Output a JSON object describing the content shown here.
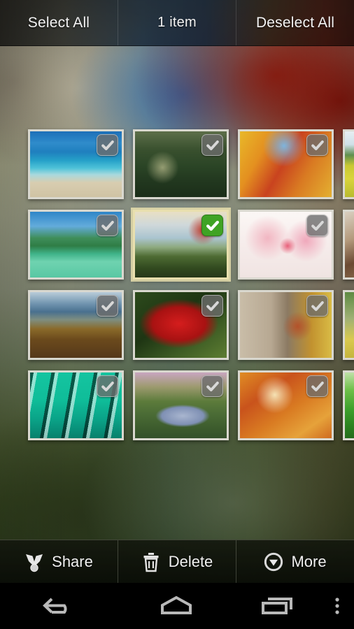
{
  "topbar": {
    "select_all_label": "Select All",
    "count_label": "1 item",
    "deselect_all_label": "Deselect All"
  },
  "grid": {
    "columns": 4,
    "selected_count": 1,
    "items": [
      {
        "name": "tropical-beach-blue-sea",
        "selected": false,
        "checkbox_icon": "check-icon"
      },
      {
        "name": "coastal-hillside-at-dusk",
        "selected": false,
        "checkbox_icon": "check-icon"
      },
      {
        "name": "autumn-trees-orange-foliage",
        "selected": false,
        "checkbox_icon": "check-icon"
      },
      {
        "name": "yellow-rapeseed-field",
        "selected": false,
        "checkbox_icon": "check-icon"
      },
      {
        "name": "island-beach-longtail-boat",
        "selected": false,
        "checkbox_icon": "check-icon"
      },
      {
        "name": "lone-tree-in-green-meadow",
        "selected": true,
        "checkbox_icon": "check-icon"
      },
      {
        "name": "pink-azalea-blossoms",
        "selected": false,
        "checkbox_icon": "check-icon"
      },
      {
        "name": "portrait-woman-brown-hair",
        "selected": false,
        "checkbox_icon": "check-icon"
      },
      {
        "name": "mountain-lake-boardwalk",
        "selected": false,
        "checkbox_icon": "check-icon"
      },
      {
        "name": "red-canna-lily-flowers",
        "selected": false,
        "checkbox_icon": "check-icon"
      },
      {
        "name": "girl-by-rock-wall-autumn",
        "selected": false,
        "checkbox_icon": "check-icon"
      },
      {
        "name": "yellow-flowers-bouquet",
        "selected": false,
        "checkbox_icon": "check-icon"
      },
      {
        "name": "teal-abstract-feather-pattern",
        "selected": false,
        "checkbox_icon": "check-icon"
      },
      {
        "name": "painted-pond-with-swans",
        "selected": false,
        "checkbox_icon": "check-icon"
      },
      {
        "name": "autumn-forest-path-orange",
        "selected": false,
        "checkbox_icon": "check-icon"
      },
      {
        "name": "green-gradient-leaf",
        "selected": false,
        "checkbox_icon": "check-icon"
      }
    ]
  },
  "actionbar": {
    "share_label": "Share",
    "share_icon": "share-icon",
    "delete_label": "Delete",
    "delete_icon": "trash-icon",
    "more_label": "More",
    "more_icon": "circle-chevron-down-icon"
  },
  "navbar": {
    "back_icon": "back-arrow-icon",
    "home_icon": "home-icon",
    "recent_icon": "recent-apps-icon",
    "menu_icon": "overflow-menu-icon"
  },
  "colors": {
    "selected_checkbox": "#3fa324",
    "unselected_checkbox": "#6c6c6c",
    "selected_border": "#e8dfae",
    "thumb_border": "#ecead8",
    "text": "#f3f3f3",
    "navbar_bg": "#000000"
  }
}
